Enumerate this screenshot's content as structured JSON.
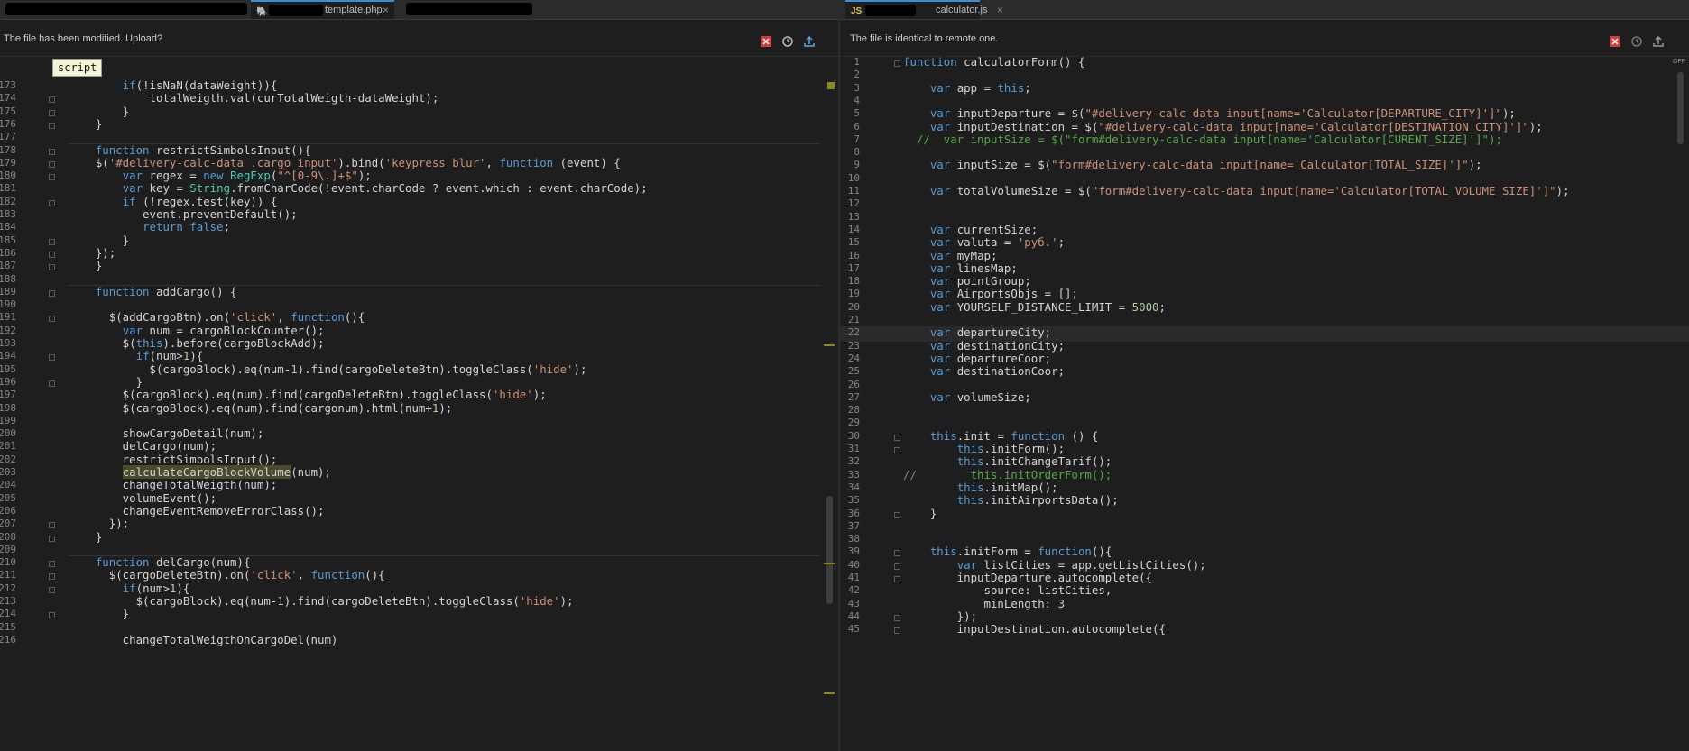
{
  "left": {
    "tabs": [
      {
        "label": "",
        "redacted": true
      },
      {
        "label": "template.php",
        "icon": "php-file-icon",
        "close": "×",
        "active": true
      },
      {
        "label": "",
        "redacted": true
      }
    ],
    "notice": "The file has been modified. Upload?",
    "tooltip": "script",
    "actions": [
      "discard-icon",
      "history-icon",
      "upload-icon"
    ],
    "lines": [
      {
        "n": "173",
        "t": "        if(!isNaN(dataWeight)){"
      },
      {
        "n": "174",
        "t": "            totalWeigth.val(curTotalWeigth-dataWeight);"
      },
      {
        "n": "175",
        "t": "        }"
      },
      {
        "n": "176",
        "t": "    }"
      },
      {
        "n": "177",
        "t": ""
      },
      {
        "n": "178",
        "t": "    function restrictSimbolsInput(){"
      },
      {
        "n": "179",
        "t": "    $('#delivery-calc-data .cargo input').bind('keypress blur', function (event) {"
      },
      {
        "n": "180",
        "t": "        var regex = new RegExp(\"^[0-9\\.]+$\");"
      },
      {
        "n": "181",
        "t": "        var key = String.fromCharCode(!event.charCode ? event.which : event.charCode);"
      },
      {
        "n": "182",
        "t": "        if (!regex.test(key)) {"
      },
      {
        "n": "183",
        "t": "           event.preventDefault();"
      },
      {
        "n": "184",
        "t": "           return false;"
      },
      {
        "n": "185",
        "t": "        }"
      },
      {
        "n": "186",
        "t": "    });"
      },
      {
        "n": "187",
        "t": "    }"
      },
      {
        "n": "188",
        "t": ""
      },
      {
        "n": "189",
        "t": "    function addCargo() {"
      },
      {
        "n": "190",
        "t": ""
      },
      {
        "n": "191",
        "t": "      $(addCargoBtn).on('click', function(){"
      },
      {
        "n": "192",
        "t": "        var num = cargoBlockCounter();"
      },
      {
        "n": "193",
        "t": "        $(this).before(cargoBlockAdd);"
      },
      {
        "n": "194",
        "t": "          if(num>1){"
      },
      {
        "n": "195",
        "t": "            $(cargoBlock).eq(num-1).find(cargoDeleteBtn).toggleClass('hide');"
      },
      {
        "n": "196",
        "t": "          }"
      },
      {
        "n": "197",
        "t": "        $(cargoBlock).eq(num).find(cargoDeleteBtn).toggleClass('hide');"
      },
      {
        "n": "198",
        "t": "        $(cargoBlock).eq(num).find(cargonum).html(num+1);"
      },
      {
        "n": "199",
        "t": ""
      },
      {
        "n": "200",
        "t": "        showCargoDetail(num);"
      },
      {
        "n": "201",
        "t": "        delCargo(num);"
      },
      {
        "n": "202",
        "t": "        restrictSimbolsInput();"
      },
      {
        "n": "203",
        "t": "        calculateCargoBlockVolume(num);"
      },
      {
        "n": "204",
        "t": "        changeTotalWeigth(num);"
      },
      {
        "n": "205",
        "t": "        volumeEvent();"
      },
      {
        "n": "206",
        "t": "        changeEventRemoveErrorClass();"
      },
      {
        "n": "207",
        "t": "      });"
      },
      {
        "n": "208",
        "t": "    }"
      },
      {
        "n": "209",
        "t": ""
      },
      {
        "n": "210",
        "t": "    function delCargo(num){"
      },
      {
        "n": "211",
        "t": "      $(cargoDeleteBtn).on('click', function(){"
      },
      {
        "n": "212",
        "t": "        if(num>1){"
      },
      {
        "n": "213",
        "t": "          $(cargoBlock).eq(num-1).find(cargoDeleteBtn).toggleClass('hide');"
      },
      {
        "n": "214",
        "t": "        }"
      },
      {
        "n": "215",
        "t": ""
      },
      {
        "n": "216",
        "t": "        changeTotalWeigthOnCargoDel(num)"
      }
    ]
  },
  "right": {
    "tabs": [
      {
        "label": "calculator.js",
        "icon": "js-file-icon",
        "close": "×",
        "active": true,
        "redacted_prefix": true
      }
    ],
    "notice": "The file is identical to remote one.",
    "actions": [
      "discard-icon",
      "history-icon",
      "upload-icon"
    ],
    "minimap_label": "OFF",
    "lines": [
      {
        "n": "1",
        "t": "function calculatorForm() {"
      },
      {
        "n": "2",
        "t": ""
      },
      {
        "n": "3",
        "t": "    var app = this;"
      },
      {
        "n": "4",
        "t": ""
      },
      {
        "n": "5",
        "t": "    var inputDeparture = $(\"#delivery-calc-data input[name='Calculator[DEPARTURE_CITY]']\");"
      },
      {
        "n": "6",
        "t": "    var inputDestination = $(\"#delivery-calc-data input[name='Calculator[DESTINATION_CITY]']\");"
      },
      {
        "n": "7",
        "t": "  //  var inputSize = $(\"form#delivery-calc-data input[name='Calculator[CURENT_SIZE]']\");"
      },
      {
        "n": "8",
        "t": ""
      },
      {
        "n": "9",
        "t": "    var inputSize = $(\"form#delivery-calc-data input[name='Calculator[TOTAL_SIZE]']\");"
      },
      {
        "n": "10",
        "t": ""
      },
      {
        "n": "11",
        "t": "    var totalVolumeSize = $(\"form#delivery-calc-data input[name='Calculator[TOTAL_VOLUME_SIZE]']\");"
      },
      {
        "n": "12",
        "t": ""
      },
      {
        "n": "13",
        "t": ""
      },
      {
        "n": "14",
        "t": "    var currentSize;"
      },
      {
        "n": "15",
        "t": "    var valuta = 'руб.';"
      },
      {
        "n": "16",
        "t": "    var myMap;"
      },
      {
        "n": "17",
        "t": "    var linesMap;"
      },
      {
        "n": "18",
        "t": "    var pointGroup;"
      },
      {
        "n": "19",
        "t": "    var AirportsObjs = [];"
      },
      {
        "n": "20",
        "t": "    var YOURSELF_DISTANCE_LIMIT = 5000;"
      },
      {
        "n": "21",
        "t": ""
      },
      {
        "n": "22",
        "t": "    var departureCity;"
      },
      {
        "n": "23",
        "t": "    var destinationCity;"
      },
      {
        "n": "24",
        "t": "    var departureCoor;"
      },
      {
        "n": "25",
        "t": "    var destinationCoor;"
      },
      {
        "n": "26",
        "t": ""
      },
      {
        "n": "27",
        "t": "    var volumeSize;"
      },
      {
        "n": "28",
        "t": ""
      },
      {
        "n": "29",
        "t": ""
      },
      {
        "n": "30",
        "t": "    this.init = function () {"
      },
      {
        "n": "31",
        "t": "        this.initForm();"
      },
      {
        "n": "32",
        "t": "        this.initChangeTarif();"
      },
      {
        "n": "33",
        "t": "//        this.initOrderForm();"
      },
      {
        "n": "34",
        "t": "        this.initMap();"
      },
      {
        "n": "35",
        "t": "        this.initAirportsData();"
      },
      {
        "n": "36",
        "t": "    }"
      },
      {
        "n": "37",
        "t": ""
      },
      {
        "n": "38",
        "t": ""
      },
      {
        "n": "39",
        "t": "    this.initForm = function(){"
      },
      {
        "n": "40",
        "t": "        var listCities = app.getListCities();"
      },
      {
        "n": "41",
        "t": "        inputDeparture.autocomplete({"
      },
      {
        "n": "42",
        "t": "            source: listCities,"
      },
      {
        "n": "43",
        "t": "            minLength: 3"
      },
      {
        "n": "44",
        "t": "        });"
      },
      {
        "n": "45",
        "t": "        inputDestination.autocomplete({"
      }
    ]
  }
}
